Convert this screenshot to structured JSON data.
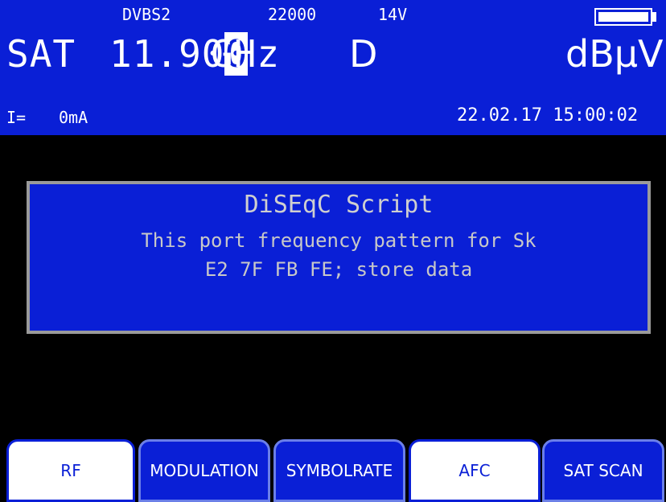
{
  "header": {
    "modulation": "DVBS2",
    "symbol_rate": "22000",
    "lnb_voltage": "14V",
    "band": "SAT",
    "freq_prefix": "11.90",
    "freq_cursor_digit": "0",
    "freq_unit": "GHz",
    "polarization": "D",
    "level_unit": "dBµV",
    "current_label": "I=",
    "current_value": "0mA",
    "datetime": "22.02.17 15:00:02",
    "battery_icon": "battery-full-icon",
    "battery_level": 1.0
  },
  "dialog": {
    "title": "DiSEqC Script",
    "line1": "This port frequency pattern for Sk",
    "line2": "E2 7F FB FE; store data"
  },
  "softkeys": [
    {
      "label": "RF",
      "active": true
    },
    {
      "label": "MODULATION",
      "active": false
    },
    {
      "label": "SYMBOLRATE",
      "active": false
    },
    {
      "label": "AFC",
      "active": true
    },
    {
      "label": "SAT SCAN",
      "active": false
    }
  ],
  "colors": {
    "header_bg": "#0a1fd6",
    "screen_bg": "#000000",
    "dialog_border": "#9a9a9a",
    "text_light": "#ffffff"
  }
}
